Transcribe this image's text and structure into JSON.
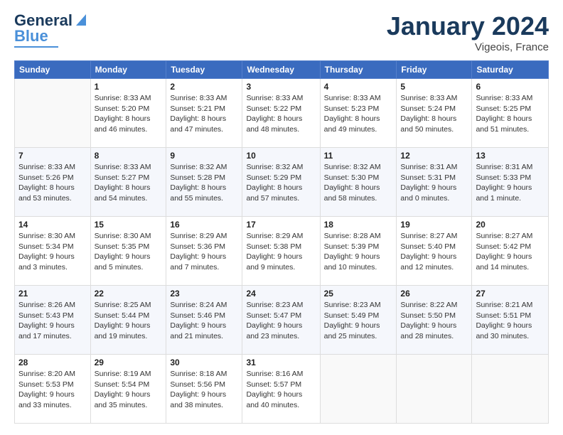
{
  "header": {
    "logo_line1": "General",
    "logo_line2": "Blue",
    "month": "January 2024",
    "location": "Vigeois, France"
  },
  "days_of_week": [
    "Sunday",
    "Monday",
    "Tuesday",
    "Wednesday",
    "Thursday",
    "Friday",
    "Saturday"
  ],
  "weeks": [
    [
      {
        "num": "",
        "sunrise": "",
        "sunset": "",
        "daylight": ""
      },
      {
        "num": "1",
        "sunrise": "Sunrise: 8:33 AM",
        "sunset": "Sunset: 5:20 PM",
        "daylight": "Daylight: 8 hours and 46 minutes."
      },
      {
        "num": "2",
        "sunrise": "Sunrise: 8:33 AM",
        "sunset": "Sunset: 5:21 PM",
        "daylight": "Daylight: 8 hours and 47 minutes."
      },
      {
        "num": "3",
        "sunrise": "Sunrise: 8:33 AM",
        "sunset": "Sunset: 5:22 PM",
        "daylight": "Daylight: 8 hours and 48 minutes."
      },
      {
        "num": "4",
        "sunrise": "Sunrise: 8:33 AM",
        "sunset": "Sunset: 5:23 PM",
        "daylight": "Daylight: 8 hours and 49 minutes."
      },
      {
        "num": "5",
        "sunrise": "Sunrise: 8:33 AM",
        "sunset": "Sunset: 5:24 PM",
        "daylight": "Daylight: 8 hours and 50 minutes."
      },
      {
        "num": "6",
        "sunrise": "Sunrise: 8:33 AM",
        "sunset": "Sunset: 5:25 PM",
        "daylight": "Daylight: 8 hours and 51 minutes."
      }
    ],
    [
      {
        "num": "7",
        "sunrise": "Sunrise: 8:33 AM",
        "sunset": "Sunset: 5:26 PM",
        "daylight": "Daylight: 8 hours and 53 minutes."
      },
      {
        "num": "8",
        "sunrise": "Sunrise: 8:33 AM",
        "sunset": "Sunset: 5:27 PM",
        "daylight": "Daylight: 8 hours and 54 minutes."
      },
      {
        "num": "9",
        "sunrise": "Sunrise: 8:32 AM",
        "sunset": "Sunset: 5:28 PM",
        "daylight": "Daylight: 8 hours and 55 minutes."
      },
      {
        "num": "10",
        "sunrise": "Sunrise: 8:32 AM",
        "sunset": "Sunset: 5:29 PM",
        "daylight": "Daylight: 8 hours and 57 minutes."
      },
      {
        "num": "11",
        "sunrise": "Sunrise: 8:32 AM",
        "sunset": "Sunset: 5:30 PM",
        "daylight": "Daylight: 8 hours and 58 minutes."
      },
      {
        "num": "12",
        "sunrise": "Sunrise: 8:31 AM",
        "sunset": "Sunset: 5:31 PM",
        "daylight": "Daylight: 9 hours and 0 minutes."
      },
      {
        "num": "13",
        "sunrise": "Sunrise: 8:31 AM",
        "sunset": "Sunset: 5:33 PM",
        "daylight": "Daylight: 9 hours and 1 minute."
      }
    ],
    [
      {
        "num": "14",
        "sunrise": "Sunrise: 8:30 AM",
        "sunset": "Sunset: 5:34 PM",
        "daylight": "Daylight: 9 hours and 3 minutes."
      },
      {
        "num": "15",
        "sunrise": "Sunrise: 8:30 AM",
        "sunset": "Sunset: 5:35 PM",
        "daylight": "Daylight: 9 hours and 5 minutes."
      },
      {
        "num": "16",
        "sunrise": "Sunrise: 8:29 AM",
        "sunset": "Sunset: 5:36 PM",
        "daylight": "Daylight: 9 hours and 7 minutes."
      },
      {
        "num": "17",
        "sunrise": "Sunrise: 8:29 AM",
        "sunset": "Sunset: 5:38 PM",
        "daylight": "Daylight: 9 hours and 9 minutes."
      },
      {
        "num": "18",
        "sunrise": "Sunrise: 8:28 AM",
        "sunset": "Sunset: 5:39 PM",
        "daylight": "Daylight: 9 hours and 10 minutes."
      },
      {
        "num": "19",
        "sunrise": "Sunrise: 8:27 AM",
        "sunset": "Sunset: 5:40 PM",
        "daylight": "Daylight: 9 hours and 12 minutes."
      },
      {
        "num": "20",
        "sunrise": "Sunrise: 8:27 AM",
        "sunset": "Sunset: 5:42 PM",
        "daylight": "Daylight: 9 hours and 14 minutes."
      }
    ],
    [
      {
        "num": "21",
        "sunrise": "Sunrise: 8:26 AM",
        "sunset": "Sunset: 5:43 PM",
        "daylight": "Daylight: 9 hours and 17 minutes."
      },
      {
        "num": "22",
        "sunrise": "Sunrise: 8:25 AM",
        "sunset": "Sunset: 5:44 PM",
        "daylight": "Daylight: 9 hours and 19 minutes."
      },
      {
        "num": "23",
        "sunrise": "Sunrise: 8:24 AM",
        "sunset": "Sunset: 5:46 PM",
        "daylight": "Daylight: 9 hours and 21 minutes."
      },
      {
        "num": "24",
        "sunrise": "Sunrise: 8:23 AM",
        "sunset": "Sunset: 5:47 PM",
        "daylight": "Daylight: 9 hours and 23 minutes."
      },
      {
        "num": "25",
        "sunrise": "Sunrise: 8:23 AM",
        "sunset": "Sunset: 5:49 PM",
        "daylight": "Daylight: 9 hours and 25 minutes."
      },
      {
        "num": "26",
        "sunrise": "Sunrise: 8:22 AM",
        "sunset": "Sunset: 5:50 PM",
        "daylight": "Daylight: 9 hours and 28 minutes."
      },
      {
        "num": "27",
        "sunrise": "Sunrise: 8:21 AM",
        "sunset": "Sunset: 5:51 PM",
        "daylight": "Daylight: 9 hours and 30 minutes."
      }
    ],
    [
      {
        "num": "28",
        "sunrise": "Sunrise: 8:20 AM",
        "sunset": "Sunset: 5:53 PM",
        "daylight": "Daylight: 9 hours and 33 minutes."
      },
      {
        "num": "29",
        "sunrise": "Sunrise: 8:19 AM",
        "sunset": "Sunset: 5:54 PM",
        "daylight": "Daylight: 9 hours and 35 minutes."
      },
      {
        "num": "30",
        "sunrise": "Sunrise: 8:18 AM",
        "sunset": "Sunset: 5:56 PM",
        "daylight": "Daylight: 9 hours and 38 minutes."
      },
      {
        "num": "31",
        "sunrise": "Sunrise: 8:16 AM",
        "sunset": "Sunset: 5:57 PM",
        "daylight": "Daylight: 9 hours and 40 minutes."
      },
      {
        "num": "",
        "sunrise": "",
        "sunset": "",
        "daylight": ""
      },
      {
        "num": "",
        "sunrise": "",
        "sunset": "",
        "daylight": ""
      },
      {
        "num": "",
        "sunrise": "",
        "sunset": "",
        "daylight": ""
      }
    ]
  ]
}
